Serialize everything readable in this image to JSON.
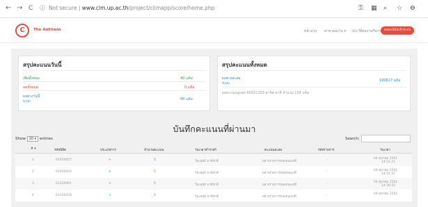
{
  "browser": {
    "nav": {
      "back": "←",
      "forward": "→",
      "reload": "C"
    },
    "security_label": "Not secure",
    "url_host": "www.clm.up.ac.th",
    "url_path": "/project/climapp/score/home.php",
    "right_icons": [
      "key-icon",
      "translate-icon",
      "search-icon",
      "star-icon",
      "account-icon"
    ]
  },
  "site": {
    "logo_glyph": "C",
    "brand": "The Antitwin",
    "menu": [
      "หน้าแรก",
      "สาขาผลงาน ▾",
      "ประวัติผลงานกิจกรรม"
    ],
    "login_label": "ลงทะเบียนเข้าระบบ"
  },
  "today_panel": {
    "title": "สรุปคะแนนวันนี้",
    "rows": [
      {
        "label": "เพิ่มทั้งหมด",
        "value": "40",
        "unit": "แต้ม",
        "color": "#2aa14a"
      },
      {
        "label": "ลดทั้งหมด",
        "value": "0",
        "unit": "แต้ม",
        "color": "#e74c3c"
      },
      {
        "label": "ผลต่างวันนี้",
        "sub": "ระบบ",
        "value": "40",
        "unit": "แต้ม",
        "color": "#2a8fd6"
      }
    ]
  },
  "total_panel": {
    "title": "สรุปคะแนนทั้งหมด",
    "label": "ผลต่างสะสม",
    "sub": "ระบบ",
    "value": "190827",
    "unit": "แต้ม",
    "note": "ผลคะแนนสูงสุด  60021303  สาขิต สาดี  จำนวน  104  แต้ม"
  },
  "history": {
    "title": "บันทึกคะแนนที่ผ่านมา",
    "show_label": "Show",
    "entries_value": "10",
    "entries_label": "entries",
    "search_label": "Search:",
    "search_value": "",
    "columns": [
      "#",
      "รหัสนิสิต",
      "ประเภทการ",
      "จำนวนคะแนน",
      "วันเวลาทำรายกี",
      "คะแนนสะสม",
      "รหัสรายการ",
      "วันเวลา"
    ],
    "rows": [
      {
        "num": "1",
        "id": "61050057",
        "type": "+",
        "amount": "5",
        "by": "วิยะยุทธ์ มาลีชาติ",
        "ref": "ผล่างรายการของตนเองที่",
        "code": "-",
        "date": "04 ตุลาคม 2561",
        "time": "14:51:21"
      },
      {
        "num": "2",
        "id": "61050024",
        "type": "+",
        "amount": "5",
        "by": "วิยะยุทธ์ มาลีชาติ",
        "ref": "ผล่างรายการของตนเองที่",
        "code": "-",
        "date": "04 ตุลาคม 2561",
        "time": "14:51:07"
      },
      {
        "num": "3",
        "id": "61350061",
        "type": "+",
        "amount": "5",
        "by": "วิยะยุทธ์ มาลีชาติ",
        "ref": "ผล่างรายการของตนเองที่",
        "code": "-",
        "date": "04 ตุลาคม 2561",
        "time": "14:50:52"
      },
      {
        "num": "4",
        "id": "61350478",
        "type": "+",
        "amount": "5",
        "by": "วิยะยุทธ์ มาลีชาติ",
        "ref": "ผล่างรายการของตนเองที่",
        "code": "-",
        "date": "04 ตุลาคม 2561",
        "time": ""
      }
    ]
  }
}
